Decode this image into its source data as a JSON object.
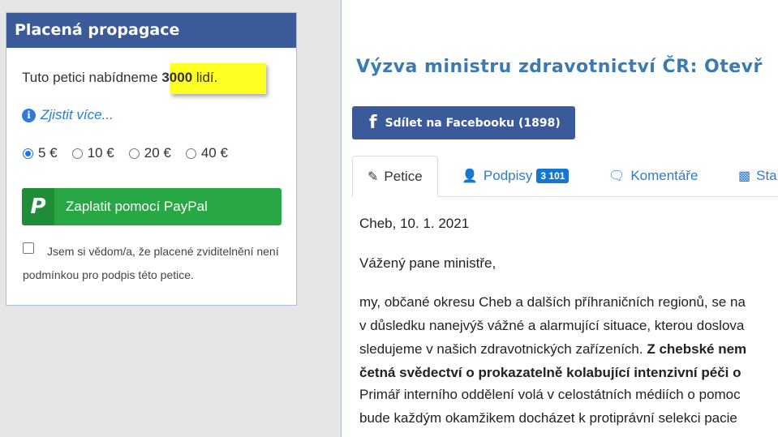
{
  "promo": {
    "title": "Placená propagace",
    "offer_prefix": "Tuto petici nabídneme",
    "offer_count": "3000",
    "offer_suffix": "lidí.",
    "more_link": "Zjistit více...",
    "amounts": [
      {
        "label": "5 €",
        "selected": true
      },
      {
        "label": "10 €",
        "selected": false
      },
      {
        "label": "20 €",
        "selected": false
      },
      {
        "label": "40 €",
        "selected": false
      }
    ],
    "paypal_label": "Zaplatit pomocí PayPal",
    "consent_text": "Jsem si vědom/a, že placené zviditelnění není podmínkou pro podpis této petice.",
    "consent_checked": false
  },
  "petition": {
    "title": "Výzva ministru zdravotnictví ČR: Otevř",
    "share_button": "Sdílet na Facebooku (1898)",
    "tabs": [
      {
        "label": "Petice",
        "icon": "pencil-icon",
        "active": true
      },
      {
        "label": "Podpisy",
        "icon": "user-icon",
        "badge": "3 101"
      },
      {
        "label": "Komentáře",
        "icon": "comments-icon"
      },
      {
        "label": "Sta",
        "icon": "bar-chart-icon"
      }
    ],
    "body": {
      "dateline": "Cheb, 10. 1. 2021",
      "salutation": "Vážený pane ministře,",
      "line1": "my, občané okresu Cheb a dalších příhraničních regionů, se na",
      "line2": "v důsledku nanejvýš vážné a alarmující situace, kterou doslova",
      "line3_plain": "sledujeme v našich zdravotnických zařízeních.",
      "line3_bold": "Z chebské nem",
      "line4_bold": "četná svědectví o prokazatelně kolabující intenzivní péči o",
      "line5": "Primář interního oddělení volá v celostátních médiích o pomoc",
      "line6": "bude každým okamžikem docházet k protiprávní selekci pacie"
    }
  },
  "colors": {
    "header_blue": "#3b5a9a",
    "link_blue": "#2d7bd6",
    "paypal_green": "#28a745",
    "highlight_yellow": "#ffff22",
    "title_blue": "#3a7bb5"
  }
}
